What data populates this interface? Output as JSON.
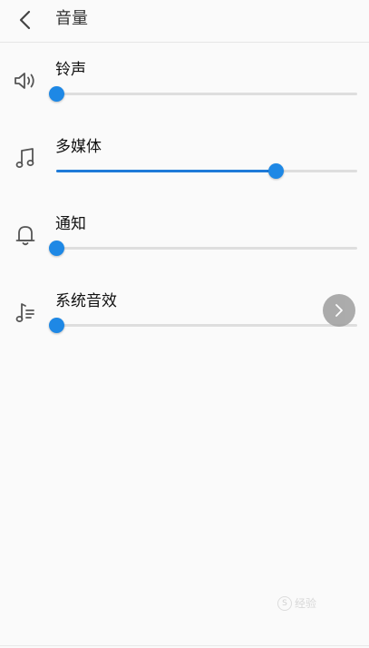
{
  "header": {
    "title": "音量",
    "back_icon": "chevron-left-icon"
  },
  "volume_rows": [
    {
      "label": "铃声",
      "icon": "speaker-icon",
      "level": 0.0
    },
    {
      "label": "多媒体",
      "icon": "music-note-icon",
      "level": 0.73
    },
    {
      "label": "通知",
      "icon": "bell-icon",
      "level": 0.0
    },
    {
      "label": "系统音效",
      "icon": "system-sound-icon",
      "level": 0.0
    }
  ],
  "floating_button": {
    "icon": "chevron-right-icon"
  },
  "watermark": {
    "text": "经验",
    "logo": "S"
  },
  "colors": {
    "accent": "#1e88e5",
    "track": "#dedede",
    "icon": "#555555"
  }
}
